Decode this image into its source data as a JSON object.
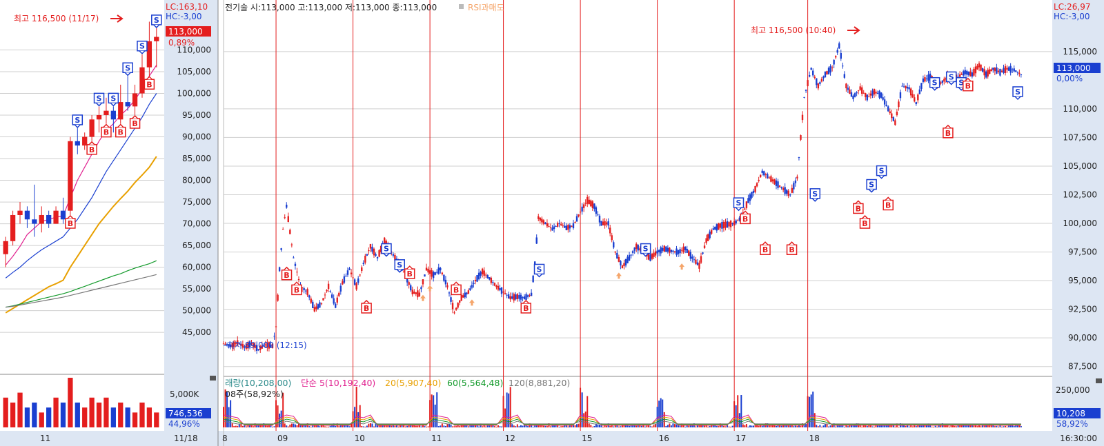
{
  "colors": {
    "up": "#e41e1e",
    "down": "#1a3fd0",
    "ma5": "#e0208f",
    "ma20": "#e8a000",
    "ma60": "#129a2a",
    "ma120": "#777777",
    "vline": "#e41e1e",
    "axis_bg": "#dde6f3",
    "grid": "#cfcfcf",
    "price_label_bg": "#1a3fd0",
    "price_label_red": "#e41e1e",
    "signal_orange": "#f5a56a"
  },
  "left_panel": {
    "lc_label": "LC:163,10",
    "hc_label": "HC:-3,00",
    "current_price_label": "113,000",
    "change_pct": "0,89%",
    "high_annotation": "최고 116,500 (11/17)",
    "x_labels": [
      "11"
    ],
    "date_label": "11/18",
    "volume_axis_label": "5,000K",
    "volume_label": "746,536",
    "volume_pct": "44,96%"
  },
  "main_panel": {
    "header": "전기술 시:113,000 고:113,000 저:113,000 종:113,000",
    "rsi_label": "RSI과매도",
    "high_annotation": "최고 116,500 (10:40)",
    "low_annotation": "최저 89,000 (12:15)",
    "lc_label": "LC:26,97",
    "hc_label": "HC:-3,00",
    "current_price_label": "113,000",
    "change_pct": "0,00%",
    "x_labels": [
      "8",
      "09",
      "10",
      "11",
      "12",
      "15",
      "16",
      "17",
      "18",
      "16:30:00"
    ],
    "volume_legend": {
      "volume": "래량(10,208,00)",
      "ma5": "단순 5(10,192,40)",
      "ma20": "20(5,907,40)",
      "ma60": "60(5,564,48)",
      "ma120": "120(8,881,20)",
      "line2": "08주(58,92%)"
    },
    "volume_axis_label": "250,000",
    "volume_label": "10,208",
    "volume_pct": "58,92%"
  },
  "chart_data": [
    {
      "type": "candlestick",
      "title": "",
      "panel": "left daily",
      "y_ticks": [
        45000,
        50000,
        55000,
        60000,
        65000,
        70000,
        75000,
        80000,
        85000,
        90000,
        95000,
        100000,
        105000,
        110000
      ],
      "y_tick_labels": [
        "45,000",
        "50,000",
        "55,000",
        "60,000",
        "65,000",
        "70,000",
        "75,000",
        "80,000",
        "85,000",
        "90,000",
        "95,000",
        "100,000",
        "105,000",
        "110,000"
      ],
      "ylim": [
        39000,
        118000
      ],
      "candles": [
        {
          "o": 63000,
          "h": 67000,
          "l": 60000,
          "c": 66000
        },
        {
          "o": 66000,
          "h": 73000,
          "l": 65000,
          "c": 72000
        },
        {
          "o": 72000,
          "h": 75000,
          "l": 70000,
          "c": 73000
        },
        {
          "o": 73000,
          "h": 74000,
          "l": 69000,
          "c": 71000
        },
        {
          "o": 71000,
          "h": 79000,
          "l": 67000,
          "c": 70000
        },
        {
          "o": 70000,
          "h": 74000,
          "l": 68000,
          "c": 72000
        },
        {
          "o": 72000,
          "h": 73000,
          "l": 69000,
          "c": 70000
        },
        {
          "o": 70000,
          "h": 74000,
          "l": 70000,
          "c": 73000
        },
        {
          "o": 73000,
          "h": 76000,
          "l": 70000,
          "c": 71000
        },
        {
          "o": 73000,
          "h": 90000,
          "l": 72000,
          "c": 89000
        },
        {
          "o": 89000,
          "h": 92000,
          "l": 86000,
          "c": 88000
        },
        {
          "o": 88000,
          "h": 91000,
          "l": 87000,
          "c": 90000
        },
        {
          "o": 90000,
          "h": 95000,
          "l": 89000,
          "c": 94000
        },
        {
          "o": 94000,
          "h": 97000,
          "l": 91000,
          "c": 95000
        },
        {
          "o": 95000,
          "h": 99000,
          "l": 93000,
          "c": 96000
        },
        {
          "o": 96000,
          "h": 97000,
          "l": 91000,
          "c": 94000
        },
        {
          "o": 94000,
          "h": 102000,
          "l": 93000,
          "c": 98000
        },
        {
          "o": 98000,
          "h": 104000,
          "l": 96000,
          "c": 97000
        },
        {
          "o": 97000,
          "h": 102000,
          "l": 95000,
          "c": 100000
        },
        {
          "o": 100000,
          "h": 109000,
          "l": 99000,
          "c": 106000
        },
        {
          "o": 106000,
          "h": 116500,
          "l": 104000,
          "c": 112000
        },
        {
          "o": 112000,
          "h": 115000,
          "l": 106000,
          "c": 113000
        }
      ],
      "ma_lines": [
        {
          "name": "ma5",
          "values": [
            60500,
            62500,
            64800,
            67500,
            69000,
            70500,
            71000,
            71500,
            71800,
            76000,
            80000,
            83000,
            86000,
            89000,
            91500,
            93000,
            95000,
            96500,
            98500,
            101000,
            104000,
            106500
          ]
        },
        {
          "name": "ma20",
          "values": [
            57500,
            58800,
            60000,
            61500,
            62800,
            64000,
            65000,
            66000,
            67000,
            69000,
            71000,
            73500,
            76000,
            79000,
            82000,
            84500,
            87000,
            89500,
            92000,
            94500,
            97500,
            100000
          ]
        },
        {
          "name": "ma60",
          "values": [
            49500,
            50500,
            51500,
            52500,
            53500,
            54500,
            55500,
            56200,
            57000,
            60000,
            62500,
            65000,
            67500,
            70000,
            72000,
            74000,
            75800,
            77500,
            79500,
            81200,
            83000,
            85500
          ]
        },
        {
          "name": "ma120",
          "values": [
            50800,
            51100,
            51500,
            51900,
            52300,
            52700,
            53100,
            53500,
            53900,
            54400,
            55000,
            55600,
            56200,
            56800,
            57400,
            58000,
            58500,
            59200,
            59800,
            60300,
            60800,
            61500
          ]
        },
        {
          "name": "ma240",
          "values": [
            50800,
            51000,
            51300,
            51600,
            51900,
            52200,
            52500,
            52800,
            53100,
            53500,
            53900,
            54300,
            54700,
            55100,
            55500,
            55900,
            56300,
            56700,
            57100,
            57500,
            57900,
            58300
          ]
        }
      ],
      "volume": [
        0.6,
        0.5,
        0.7,
        0.4,
        0.5,
        0.3,
        0.4,
        0.6,
        0.5,
        1.0,
        0.5,
        0.4,
        0.6,
        0.5,
        0.6,
        0.4,
        0.5,
        0.4,
        0.3,
        0.5,
        0.4,
        0.3
      ],
      "signals": [
        {
          "type": "B",
          "index": 9
        },
        {
          "type": "S",
          "index": 10
        },
        {
          "type": "B",
          "index": 12
        },
        {
          "type": "S",
          "index": 13
        },
        {
          "type": "B",
          "index": 14
        },
        {
          "type": "S",
          "index": 15
        },
        {
          "type": "B",
          "index": 16
        },
        {
          "type": "S",
          "index": 17
        },
        {
          "type": "B",
          "index": 18
        },
        {
          "type": "S",
          "index": 19
        },
        {
          "type": "B",
          "index": 20
        },
        {
          "type": "S",
          "index": 21
        }
      ]
    },
    {
      "type": "candlestick",
      "title": "",
      "panel": "main intraday",
      "y_ticks": [
        87500,
        90000,
        92500,
        95000,
        97500,
        100000,
        102500,
        105000,
        107500,
        110000,
        115000
      ],
      "y_tick_labels": [
        "87,500",
        "90,000",
        "92,500",
        "95,000",
        "97,500",
        "100,000",
        "102,500",
        "105,000",
        "107,500",
        "110,000",
        "115,000"
      ],
      "ylim": [
        87000,
        118000
      ],
      "path": [
        [
          0,
          89500
        ],
        [
          2,
          89300
        ],
        [
          4,
          89600
        ],
        [
          6,
          89200
        ],
        [
          8,
          89500
        ],
        [
          10,
          89000
        ],
        [
          12,
          89400
        ],
        [
          14,
          89300
        ],
        [
          15,
          91000
        ],
        [
          16,
          96000
        ],
        [
          17,
          99500
        ],
        [
          18,
          101500
        ],
        [
          20,
          97000
        ],
        [
          22,
          94500
        ],
        [
          24,
          94000
        ],
        [
          26,
          92500
        ],
        [
          28,
          93000
        ],
        [
          30,
          94500
        ],
        [
          32,
          92800
        ],
        [
          34,
          94800
        ],
        [
          36,
          96000
        ],
        [
          38,
          94500
        ],
        [
          40,
          96500
        ],
        [
          42,
          98000
        ],
        [
          44,
          97000
        ],
        [
          46,
          98500
        ],
        [
          48,
          97500
        ],
        [
          50,
          96500
        ],
        [
          52,
          95500
        ],
        [
          54,
          94000
        ],
        [
          56,
          93800
        ],
        [
          58,
          96000
        ],
        [
          60,
          95500
        ],
        [
          62,
          96000
        ],
        [
          64,
          94500
        ],
        [
          66,
          92200
        ],
        [
          68,
          93500
        ],
        [
          70,
          94000
        ],
        [
          72,
          95000
        ],
        [
          74,
          95800
        ],
        [
          76,
          95200
        ],
        [
          78,
          94500
        ],
        [
          80,
          94000
        ],
        [
          82,
          93500
        ],
        [
          84,
          93600
        ],
        [
          86,
          93500
        ],
        [
          88,
          93800
        ],
        [
          89,
          96500
        ],
        [
          90,
          100500
        ],
        [
          92,
          100000
        ],
        [
          94,
          99500
        ],
        [
          96,
          100000
        ],
        [
          98,
          99600
        ],
        [
          100,
          99800
        ],
        [
          102,
          101000
        ],
        [
          104,
          102000
        ],
        [
          106,
          101500
        ],
        [
          108,
          100000
        ],
        [
          110,
          100000
        ],
        [
          112,
          97500
        ],
        [
          114,
          96200
        ],
        [
          116,
          97000
        ],
        [
          118,
          98000
        ],
        [
          120,
          97500
        ],
        [
          122,
          97000
        ],
        [
          124,
          97500
        ],
        [
          126,
          97800
        ],
        [
          128,
          97600
        ],
        [
          130,
          97500
        ],
        [
          132,
          97800
        ],
        [
          134,
          97000
        ],
        [
          136,
          96300
        ],
        [
          138,
          98500
        ],
        [
          140,
          99500
        ],
        [
          142,
          99800
        ],
        [
          144,
          99900
        ],
        [
          146,
          100000
        ],
        [
          148,
          100500
        ],
        [
          150,
          102000
        ],
        [
          152,
          103000
        ],
        [
          154,
          104500
        ],
        [
          156,
          104000
        ],
        [
          158,
          103500
        ],
        [
          160,
          103000
        ],
        [
          162,
          102500
        ],
        [
          164,
          104000
        ],
        [
          166,
          111000
        ],
        [
          168,
          113500
        ],
        [
          170,
          112000
        ],
        [
          172,
          113000
        ],
        [
          174,
          113600
        ],
        [
          176,
          115500
        ],
        [
          178,
          112000
        ],
        [
          180,
          111000
        ],
        [
          182,
          111800
        ],
        [
          184,
          111000
        ],
        [
          186,
          111500
        ],
        [
          188,
          111200
        ],
        [
          190,
          110000
        ],
        [
          192,
          108800
        ],
        [
          194,
          112000
        ],
        [
          196,
          111800
        ],
        [
          198,
          110500
        ],
        [
          200,
          112500
        ],
        [
          202,
          112800
        ],
        [
          204,
          112000
        ],
        [
          206,
          112500
        ],
        [
          208,
          113000
        ],
        [
          210,
          112800
        ],
        [
          212,
          113200
        ],
        [
          214,
          113000
        ],
        [
          216,
          113800
        ],
        [
          218,
          113000
        ],
        [
          220,
          113500
        ],
        [
          222,
          113200
        ],
        [
          224,
          113500
        ],
        [
          226,
          113400
        ],
        [
          228,
          113000
        ]
      ],
      "sessions": [
        "8",
        "09",
        "10",
        "11",
        "12",
        "15",
        "16",
        "17",
        "18"
      ],
      "session_breaks": [
        15,
        37,
        59,
        80,
        102,
        124,
        146,
        167
      ],
      "signals": [
        {
          "type": "B",
          "i": 19,
          "v": 95500
        },
        {
          "type": "B",
          "i": 22,
          "v": 94200
        },
        {
          "type": "B",
          "i": 43,
          "v": 92600
        },
        {
          "type": "S",
          "i": 49,
          "v": 97800
        },
        {
          "type": "S",
          "i": 53,
          "v": 96400
        },
        {
          "type": "B",
          "i": 56,
          "v": 95600
        },
        {
          "type": "B",
          "i": 70,
          "v": 94200
        },
        {
          "type": "B",
          "i": 91,
          "v": 92600
        },
        {
          "type": "S",
          "i": 95,
          "v": 96000
        },
        {
          "type": "S",
          "i": 127,
          "v": 97800
        },
        {
          "type": "S",
          "i": 155,
          "v": 101800
        },
        {
          "type": "B",
          "i": 157,
          "v": 100400
        },
        {
          "type": "B",
          "i": 163,
          "v": 97700
        },
        {
          "type": "B",
          "i": 171,
          "v": 97700
        },
        {
          "type": "S",
          "i": 178,
          "v": 102600
        },
        {
          "type": "B",
          "i": 191,
          "v": 101300
        },
        {
          "type": "B",
          "i": 193,
          "v": 100000
        },
        {
          "type": "S",
          "i": 195,
          "v": 103400
        },
        {
          "type": "S",
          "i": 198,
          "v": 104600
        },
        {
          "type": "B",
          "i": 200,
          "v": 101600
        },
        {
          "type": "S",
          "i": 214,
          "v": 112300
        },
        {
          "type": "B",
          "i": 218,
          "v": 107900
        },
        {
          "type": "S",
          "i": 219,
          "v": 112800
        },
        {
          "type": "S",
          "i": 222,
          "v": 112300
        },
        {
          "type": "B",
          "i": 224,
          "v": 112000
        },
        {
          "type": "S",
          "i": 239,
          "v": 111500
        }
      ],
      "rsi_markers": [
        57,
        59,
        71,
        113,
        131
      ]
    }
  ]
}
